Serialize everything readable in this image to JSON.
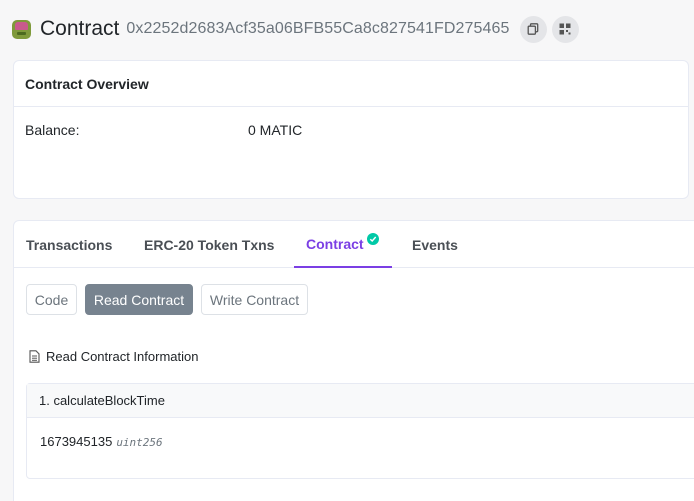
{
  "header": {
    "title": "Contract",
    "address": "0x2252d2683Acf35a06BFB55Ca8c827541FD275465",
    "logo_icon": "contract-identicon",
    "copy_icon": "copy-icon",
    "qr_icon": "qr-code-icon"
  },
  "overview": {
    "title": "Contract Overview",
    "balance_label": "Balance:",
    "balance_value": "0 MATIC"
  },
  "tabs": [
    {
      "label": "Transactions"
    },
    {
      "label": "ERC-20 Token Txns"
    },
    {
      "label": "Contract",
      "active": true,
      "verified_icon": "check-circle-icon"
    },
    {
      "label": "Events"
    }
  ],
  "sub_buttons": [
    {
      "label": "Code"
    },
    {
      "label": "Read Contract",
      "active": true
    },
    {
      "label": "Write Contract"
    }
  ],
  "read_info": {
    "icon": "document-icon",
    "label": "Read Contract Information"
  },
  "functions": [
    {
      "name": "1. calculateBlockTime",
      "value": "1673945135",
      "type": "uint256"
    }
  ],
  "colors": {
    "accent": "#7b3fe4",
    "verified": "#00c9a7",
    "active_button": "#77838f"
  }
}
